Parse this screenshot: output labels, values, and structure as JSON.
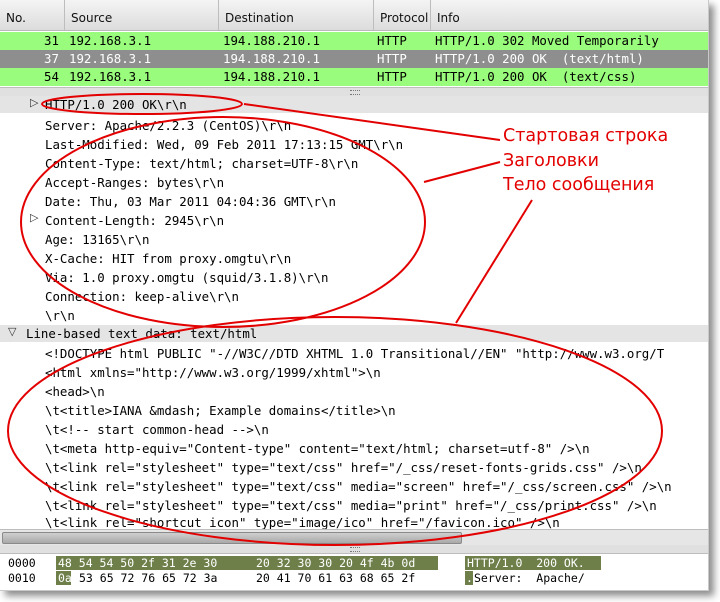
{
  "packet_list": {
    "columns": [
      "No.",
      "Source",
      "Destination",
      "Protocol",
      "Info"
    ],
    "rows": [
      {
        "no": "31",
        "source": "192.168.3.1",
        "destination": "194.188.210.1",
        "protocol": "HTTP",
        "info": "HTTP/1.0 302 Moved Temporarily",
        "color": "#9afc7c"
      },
      {
        "no": "37",
        "source": "192.168.3.1",
        "destination": "194.188.210.1",
        "protocol": "HTTP",
        "info": "HTTP/1.0 200 OK  (text/html)",
        "color": "#8e8e8e"
      },
      {
        "no": "54",
        "source": "192.168.3.1",
        "destination": "194.188.210.1",
        "protocol": "HTTP",
        "info": "HTTP/1.0 200 OK  (text/css)",
        "color": "#9afc7c"
      }
    ]
  },
  "details": {
    "status_line": "HTTP/1.0 200 OK\\r\\n",
    "headers": [
      "Server: Apache/2.2.3 (CentOS)\\r\\n",
      "Last-Modified: Wed, 09 Feb 2011 17:13:15 GMT\\r\\n",
      "Content-Type: text/html; charset=UTF-8\\r\\n",
      "Accept-Ranges: bytes\\r\\n",
      "Date: Thu, 03 Mar 2011 04:04:36 GMT\\r\\n",
      "Content-Length: 2945\\r\\n",
      "Age: 13165\\r\\n",
      "X-Cache: HIT from proxy.omgtu\\r\\n",
      "Via: 1.0 proxy.omgtu (squid/3.1.8)\\r\\n",
      "Connection: keep-alive\\r\\n",
      "\\r\\n"
    ],
    "body_section": "Line-based text data: text/html",
    "body_lines": [
      "<!DOCTYPE html PUBLIC \"-//W3C//DTD XHTML 1.0 Transitional//EN\" \"http://www.w3.org/T",
      "<html xmlns=\"http://www.w3.org/1999/xhtml\">\\n",
      "<head>\\n",
      "\\t<title>IANA &mdash; Example domains</title>\\n",
      "\\t<!-- start common-head -->\\n",
      "\\t<meta http-equiv=\"Content-type\" content=\"text/html; charset=utf-8\" />\\n",
      "\\t<link rel=\"stylesheet\" type=\"text/css\" href=\"/_css/reset-fonts-grids.css\" />\\n",
      "\\t<link rel=\"stylesheet\" type=\"text/css\" media=\"screen\" href=\"/_css/screen.css\" />\\n",
      "\\t<link rel=\"stylesheet\" type=\"text/css\" media=\"print\" href=\"/_css/print.css\" />\\n",
      "\\t<link rel=\"shortcut icon\" type=\"image/ico\" href=\"/favicon.ico\" />\\n"
    ]
  },
  "annotations": {
    "start_line": "Стартовая строка",
    "headers": "Заголовки",
    "body": "Тело сообщения",
    "color": "#e30000"
  },
  "hex": {
    "rows": [
      {
        "offset": "0000",
        "bytes_a": "48 54 54 50 2f 31 2e 30",
        "bytes_b": "20 32 30 30 20 4f 4b 0d",
        "ascii": "HTTP/1.0  200 OK."
      },
      {
        "offset": "0010",
        "first_byte": "0a",
        "bytes_a": "53 65 72 76 65 72 3a",
        "bytes_b": "20 41 70 61 63 68 65 2f",
        "ascii_first": ".",
        "ascii": "Server:  Apache/"
      }
    ]
  }
}
